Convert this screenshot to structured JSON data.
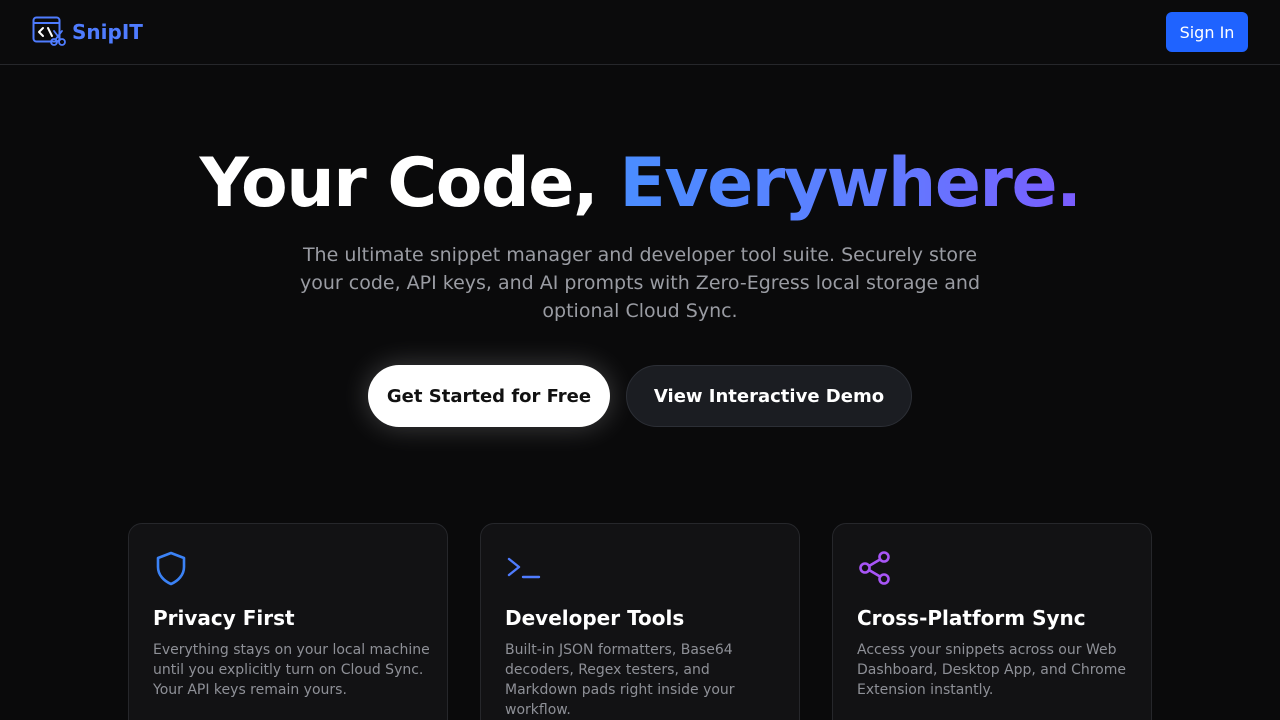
{
  "header": {
    "brand": "SnipIT",
    "signin_label": "Sign In"
  },
  "hero": {
    "title_main": "Your Code, ",
    "title_accent": "Everywhere.",
    "subtitle": "The ultimate snippet manager and developer tool suite. Securely store your code, API keys, and AI prompts with Zero-Egress local storage and optional Cloud Sync.",
    "primary_cta": "Get Started for Free",
    "secondary_cta": "View Interactive Demo"
  },
  "features": [
    {
      "icon": "shield-icon",
      "title": "Privacy First",
      "description": "Everything stays on your local machine until you explicitly turn on Cloud Sync. Your API keys remain yours."
    },
    {
      "icon": "terminal-icon",
      "title": "Developer Tools",
      "description": "Built-in JSON formatters, Base64 decoders, Regex testers, and Markdown pads right inside your workflow."
    },
    {
      "icon": "share-icon",
      "title": "Cross-Platform Sync",
      "description": "Access your snippets across our Web Dashboard, Desktop App, and Chrome Extension instantly."
    }
  ],
  "colors": {
    "brand": "#4f7cff",
    "signin_bg": "#1f63ff",
    "shield": "#3b82f6",
    "terminal": "#4f7cff",
    "share": "#a855f7",
    "background": "#0a0a0b"
  }
}
